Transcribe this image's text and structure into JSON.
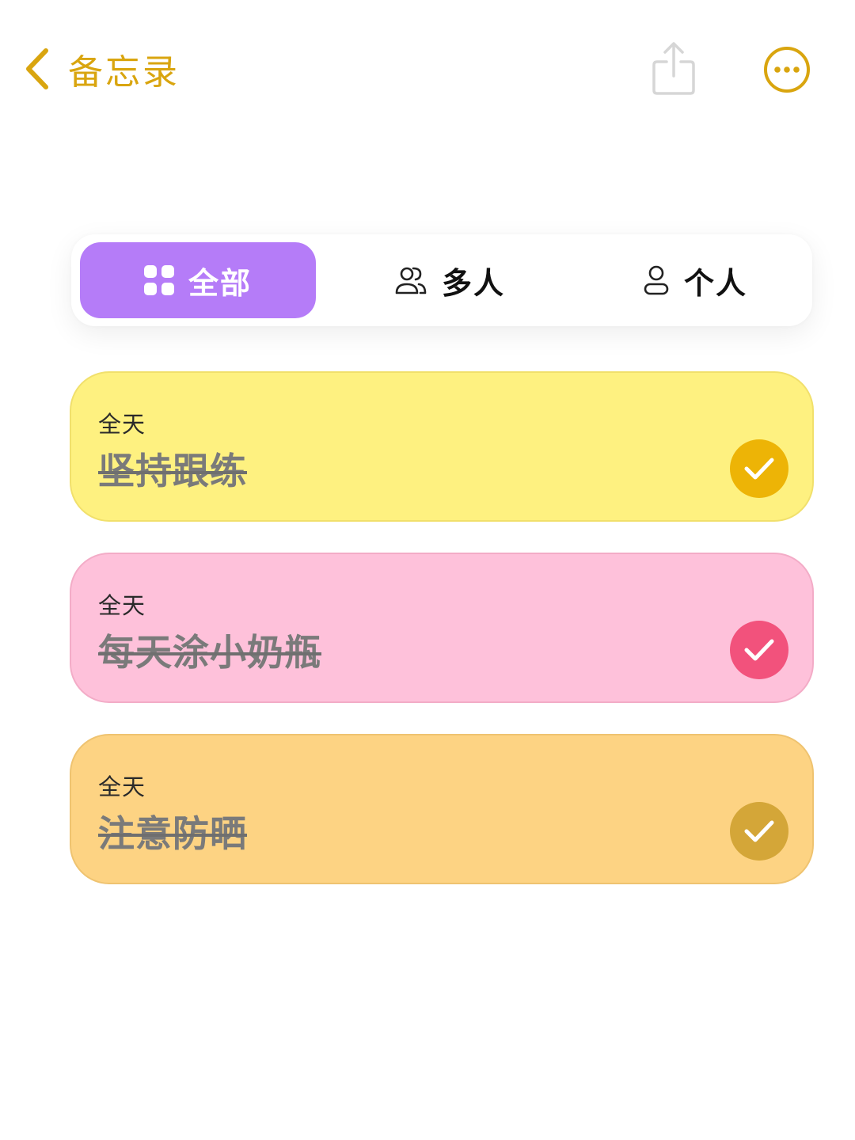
{
  "nav": {
    "back_label": "备忘录",
    "accent_color": "#D9A50F"
  },
  "tabs": [
    {
      "label": "全部",
      "icon": "grid-icon",
      "selected": true,
      "color": "#B57CF8"
    },
    {
      "label": "多人",
      "icon": "people-icon",
      "selected": false
    },
    {
      "label": "个人",
      "icon": "person-icon",
      "selected": false
    }
  ],
  "memos": [
    {
      "time": "全天",
      "title": "坚持跟练",
      "completed": true,
      "color": "#FEF180",
      "check_color": "#EDB406"
    },
    {
      "time": "全天",
      "title": "每天涂小奶瓶",
      "completed": true,
      "color": "#FEC1DA",
      "check_color": "#F2527C"
    },
    {
      "time": "全天",
      "title": "注意防晒",
      "completed": true,
      "color": "#FDD383",
      "check_color": "#D4A638"
    }
  ]
}
